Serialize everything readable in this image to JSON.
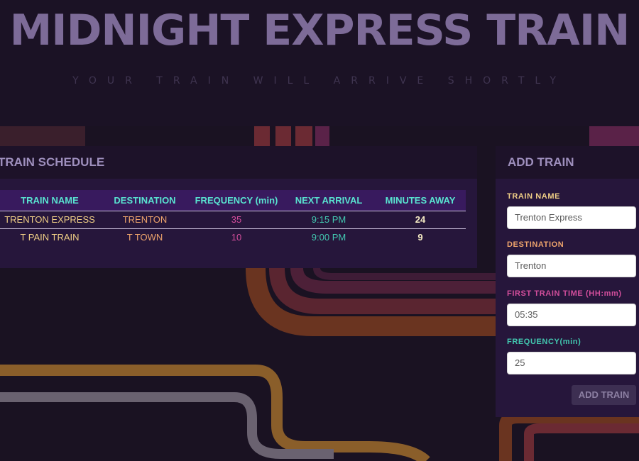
{
  "header": {
    "title": "MIDNIGHT EXPRESS TRAIN",
    "subtitle": "YOUR TRAIN WILL ARRIVE SHORTLY"
  },
  "schedule": {
    "heading": "TRAIN SCHEDULE",
    "columns": [
      "TRAIN NAME",
      "DESTINATION",
      "FREQUENCY (min)",
      "NEXT ARRIVAL",
      "MINUTES AWAY"
    ],
    "rows": [
      {
        "name": "TRENTON EXPRESS",
        "destination": "TRENTON",
        "frequency": "35",
        "next_arrival": "9:15 PM",
        "minutes_away": "24"
      },
      {
        "name": "T PAIN TRAIN",
        "destination": "T TOWN",
        "frequency": "10",
        "next_arrival": "9:00 PM",
        "minutes_away": "9"
      }
    ]
  },
  "add_train": {
    "heading": "ADD TRAIN",
    "fields": [
      {
        "label": "TRAIN NAME",
        "value": "Trenton Express",
        "color": "#f0cf86"
      },
      {
        "label": "DESTINATION",
        "value": "Trenton",
        "color": "#eea46c"
      },
      {
        "label": "FIRST TRAIN TIME (HH:mm)",
        "value": "05:35",
        "color": "#d34e9c"
      },
      {
        "label": "FREQUENCY(min)",
        "value": "25",
        "color": "#42c8b0"
      }
    ],
    "button_label": "ADD TRAIN"
  },
  "colors": {
    "background": "#1a1222",
    "panel": "#26163b",
    "table_header": "#381a5e",
    "title": "#7d6b98",
    "track_red": "#6b2a33",
    "track_orange": "#8a4a2a",
    "track_yellow": "#9a6a2e",
    "track_grey": "#6a6270"
  }
}
